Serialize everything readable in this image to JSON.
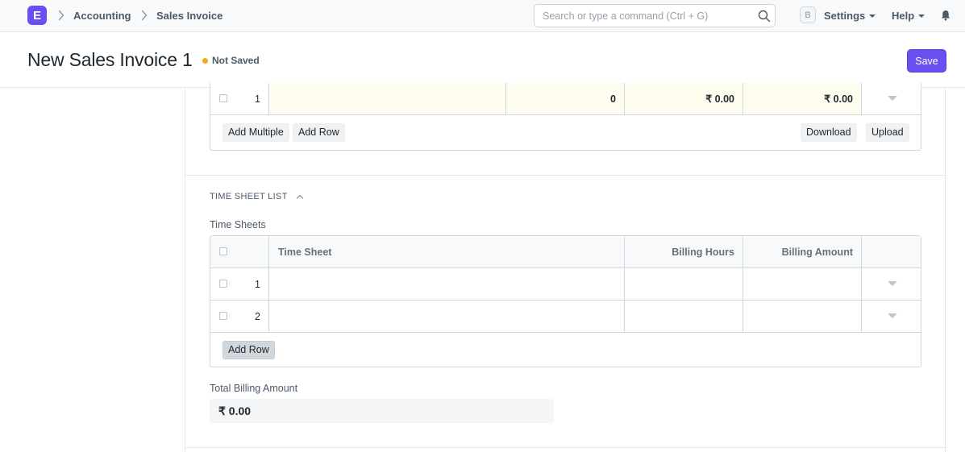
{
  "navbar": {
    "logo_letter": "E",
    "breadcrumbs": [
      "Accounting",
      "Sales Invoice"
    ],
    "search_placeholder": "Search or type a command (Ctrl + G)",
    "avatar_letter": "B",
    "settings_label": "Settings",
    "help_label": "Help"
  },
  "page": {
    "title": "New Sales Invoice 1",
    "status": "Not Saved",
    "save_label": "Save",
    "status_color": "#f8a51f",
    "accent_color": "#6b4ef2"
  },
  "items_grid": {
    "rows": [
      {
        "idx": "1",
        "qty": "0",
        "rate": "₹ 0.00",
        "amount": "₹ 0.00"
      }
    ],
    "add_multiple_label": "Add Multiple",
    "add_row_label": "Add Row",
    "download_label": "Download",
    "upload_label": "Upload"
  },
  "timesheet_section": {
    "title": "TIME SHEET LIST",
    "table_label": "Time Sheets",
    "columns": [
      "Time Sheet",
      "Billing Hours",
      "Billing Amount"
    ],
    "rows": [
      {
        "idx": "1",
        "time_sheet": "",
        "billing_hours": "",
        "billing_amount": ""
      },
      {
        "idx": "2",
        "time_sheet": "",
        "billing_hours": "",
        "billing_amount": ""
      }
    ],
    "add_row_label": "Add Row",
    "total_label": "Total Billing Amount",
    "total_value": "₹ 0.00"
  }
}
